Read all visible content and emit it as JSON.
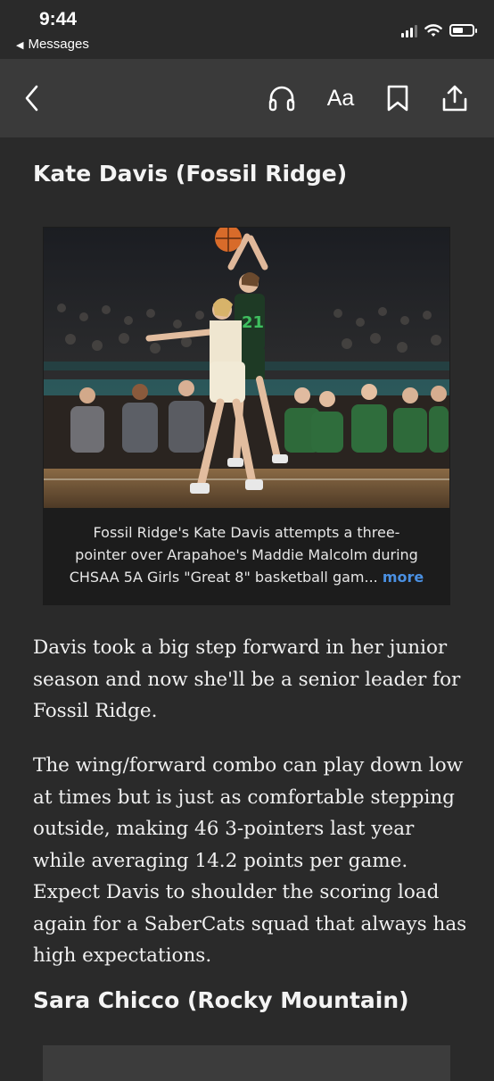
{
  "status_bar": {
    "time": "9:44",
    "back_app_label": "Messages",
    "back_app_icon": "triangle-left-icon",
    "cellular_icon": "cellular-signal-icon",
    "wifi_icon": "wifi-icon",
    "battery_icon": "battery-icon"
  },
  "toolbar": {
    "back_icon": "chevron-left-icon",
    "listen_icon": "headphones-icon",
    "text_size_label": "Aa",
    "bookmark_icon": "bookmark-icon",
    "share_icon": "share-icon"
  },
  "article": {
    "section_1_heading": "Kate Davis (Fossil Ridge)",
    "photo_caption_lines": [
      "Fossil Ridge's Kate Davis attempts a three-",
      "pointer over Arapahoe's Maddie Malcolm during",
      "CHSAA 5A Girls \"Great 8\" basketball gam..."
    ],
    "caption_more_label": "more",
    "paragraph_1_lines": [
      "Davis took a big step forward in her junior",
      "season and now she'll be a senior leader for",
      "Fossil Ridge."
    ],
    "paragraph_2_lines": [
      "The wing/forward combo can play down low",
      "at times but is just as comfortable stepping",
      "outside, making 46 3-pointers last year",
      "while averaging 14.2 points per game.",
      "Expect Davis to shoulder the scoring load",
      "again for a SaberCats squad that always has",
      "high expectations."
    ],
    "section_2_heading": "Sara Chicco (Rocky Mountain)"
  },
  "photo": {
    "player_jersey_number": "21"
  },
  "colors": {
    "background": "#2a2a2a",
    "toolbar": "#3a3a3a",
    "caption_background": "#1c1c1c",
    "link": "#4a90e2",
    "jersey_green": "#1e3a25",
    "jersey_number": "#3fbf5f"
  }
}
